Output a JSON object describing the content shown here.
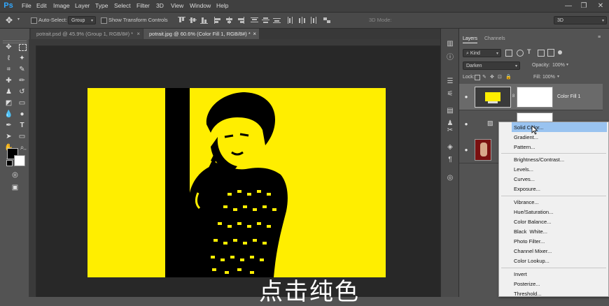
{
  "app": {
    "logo": "Ps"
  },
  "menu": [
    "File",
    "Edit",
    "Image",
    "Layer",
    "Type",
    "Select",
    "Filter",
    "3D",
    "View",
    "Window",
    "Help"
  ],
  "window_controls": [
    "—",
    "❐",
    "✕"
  ],
  "options_bar": {
    "auto_select_label": "Auto-Select:",
    "auto_select_value": "Group",
    "transform_label": "Show Transform Controls",
    "mode_3d_label": "3D Mode:",
    "workspace_value": "3D"
  },
  "tabs": [
    {
      "label": "potrait.psd @ 45.9% (Group 1, RGB/8#) *",
      "close": "×",
      "active": false
    },
    {
      "label": "potrait.jpg @ 60.6% (Color Fill 1, RGB/8#) *",
      "close": "×",
      "active": true
    }
  ],
  "layers_panel": {
    "tabs": [
      "Layers",
      "Channels"
    ],
    "filter_value": "Kind",
    "blend_mode": "Darken",
    "opacity_label": "Opacity:",
    "opacity_value": "100%",
    "lock_label": "Lock:",
    "fill_label": "Fill:",
    "fill_value": "100%",
    "layers": [
      {
        "name": "Color Fill 1",
        "selected": true
      },
      {
        "name": "",
        "selected": false
      },
      {
        "name": "",
        "selected": false
      }
    ]
  },
  "context_menu": {
    "groups": [
      [
        "Solid Color...",
        "Gradient...",
        "Pattern..."
      ],
      [
        "Brightness/Contrast...",
        "Levels...",
        "Curves...",
        "Exposure..."
      ],
      [
        "Vibrance...",
        "Hue/Saturation...",
        "Color Balance...",
        "Black  White...",
        "Photo Filter...",
        "Channel Mixer...",
        "Color Lookup..."
      ],
      [
        "Invert",
        "Posterize...",
        "Threshold..."
      ]
    ],
    "highlighted": "Solid Color..."
  },
  "subtitle": "点击纯色",
  "colors": {
    "fill_yellow": "#ffee00",
    "menu_highlight": "#99c3f0",
    "accent_blue": "#31a8ff"
  },
  "icons": [
    "move-tool-icon",
    "marquee-tool-icon",
    "lasso-tool-icon",
    "magic-wand-icon",
    "crop-tool-icon",
    "eyedropper-icon",
    "healing-brush-icon",
    "brush-tool-icon",
    "clone-stamp-icon",
    "history-brush-icon",
    "eraser-icon",
    "gradient-tool-icon",
    "blur-tool-icon",
    "dodge-tool-icon",
    "pen-tool-icon",
    "type-tool-icon",
    "path-selection-icon",
    "rectangle-tool-icon",
    "hand-tool-icon",
    "zoom-tool-icon",
    "eye-icon",
    "mouse-cursor-icon"
  ]
}
